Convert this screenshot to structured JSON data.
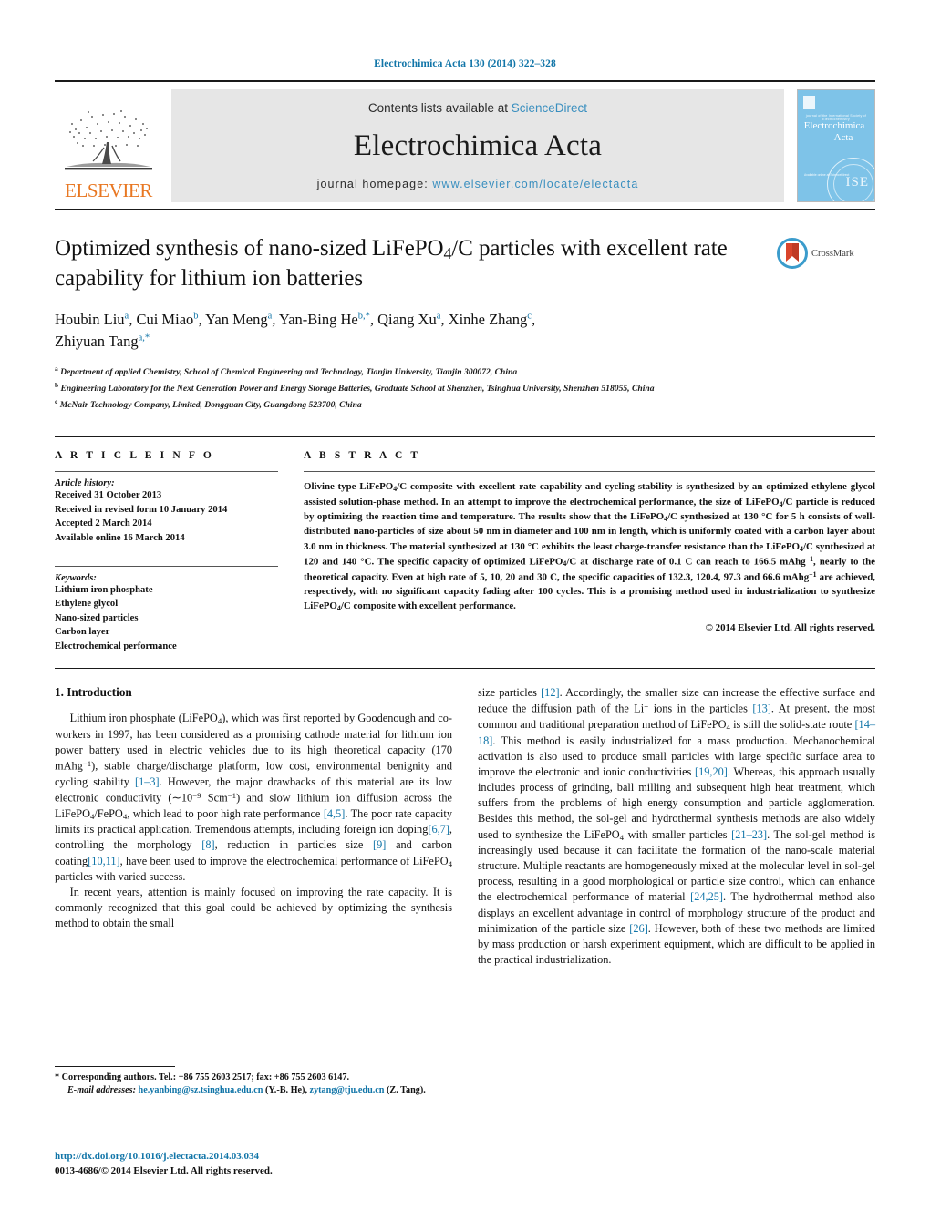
{
  "running_head": "Electrochimica Acta 130 (2014) 322–328",
  "banner": {
    "publisher_logo_text": "ELSEVIER",
    "contents_prefix": "Contents lists available at",
    "contents_link": "ScienceDirect",
    "journal_name": "Electrochimica Acta",
    "homepage_prefix": "journal homepage:",
    "homepage_url": "www.elsevier.com/locate/electacta",
    "cover": {
      "subtitle": "journal of the International Society of Electrochemistry",
      "title_line1": "Electrochimica",
      "title_line2": "Acta",
      "footer": "Available online at\nScienceDirect",
      "seal_text": "ISE"
    },
    "colors": {
      "link_blue": "#3a8fbf",
      "elsevier_orange": "#e87722",
      "banner_gray": "#e6e6e6",
      "cover_blue": "#7ec3e8"
    }
  },
  "article": {
    "title": "Optimized synthesis of nano-sized LiFePO4/C particles with excellent rate capability for lithium ion batteries",
    "crossmark_label": "CrossMark",
    "authors_line1": "Houbin Liu, Cui Miao, Yan Meng, Yan-Bing He, Qiang Xu, Xinhe Zhang,",
    "authors_line2": "Zhiyuan Tang",
    "affiliations": [
      {
        "marker": "a",
        "text": "Department of applied Chemistry, School of Chemical Engineering and Technology, Tianjin University, Tianjin 300072, China"
      },
      {
        "marker": "b",
        "text": "Engineering Laboratory for the Next Generation Power and Energy Storage Batteries, Graduate School at Shenzhen, Tsinghua University, Shenzhen 518055, China"
      },
      {
        "marker": "c",
        "text": "McNair Technology Company, Limited, Dongguan City, Guangdong 523700, China"
      }
    ]
  },
  "article_info": {
    "heading": "A R T I C L E   I N F O",
    "history_label": "Article history:",
    "history": [
      "Received 31 October 2013",
      "Received in revised form 10 January 2014",
      "Accepted 2 March 2014",
      "Available online 16 March 2014"
    ],
    "keywords_label": "Keywords:",
    "keywords": [
      "Lithium iron phosphate",
      "Ethylene glycol",
      "Nano-sized particles",
      "Carbon layer",
      "Electrochemical performance"
    ]
  },
  "abstract": {
    "heading": "A B S T R A C T",
    "copyright": "© 2014 Elsevier Ltd. All rights reserved."
  },
  "introduction": {
    "heading": "1.  Introduction"
  },
  "footnote": {
    "corresponding": "*  Corresponding authors. Tel.: +86 755 2603 2517; fax: +86 755 2603 6147.",
    "email_label": "E-mail addresses:",
    "email1": "he.yanbing@sz.tsinghua.edu.cn",
    "email1_owner": "(Y.-B. He),",
    "email2": "zytang@tju.edu.cn",
    "email2_owner": "(Z. Tang)."
  },
  "footer": {
    "doi": "http://dx.doi.org/10.1016/j.electacta.2014.03.034",
    "issn_line": "0013-4686/© 2014 Elsevier Ltd. All rights reserved."
  }
}
